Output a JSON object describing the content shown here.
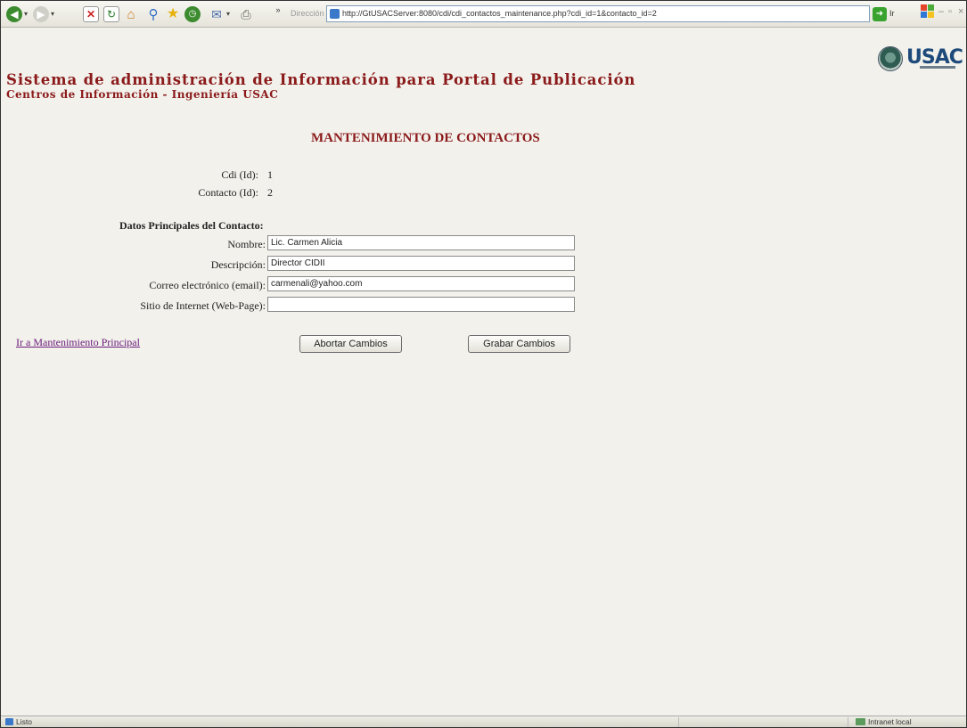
{
  "browser": {
    "address_label": "Dirección",
    "url": "http://GtUSACServer:8080/cdi/cdi_contactos_maintenance.php?cdi_id=1&contacto_id=2",
    "go_label": "Ir",
    "status_text": "Listo",
    "zone_text": "Intranet local"
  },
  "logo": {
    "text": "USAC"
  },
  "header": {
    "title": "Sistema de administración de Información para Portal de Publicación",
    "subtitle": "Centros de Información - Ingeniería USAC"
  },
  "page": {
    "heading": "MANTENIMIENTO DE CONTACTOS",
    "cdi_label": "Cdi (Id):",
    "cdi_value": "1",
    "contacto_label": "Contacto (Id):",
    "contacto_value": "2",
    "section_title": "Datos Principales del Contacto:"
  },
  "form": {
    "nombre_label": "Nombre:",
    "nombre_value": "Lic. Carmen Alicia",
    "descripcion_label": "Descripción:",
    "descripcion_value": "Director CIDII",
    "email_label": "Correo electrónico (email):",
    "email_value": "carmenali@yahoo.com",
    "web_label": "Sitio de Internet (Web-Page):",
    "web_value": ""
  },
  "actions": {
    "link_main": "Ir a Mantenimiento Principal",
    "abort_label": "Abortar Cambios",
    "save_label": "Grabar Cambios"
  }
}
